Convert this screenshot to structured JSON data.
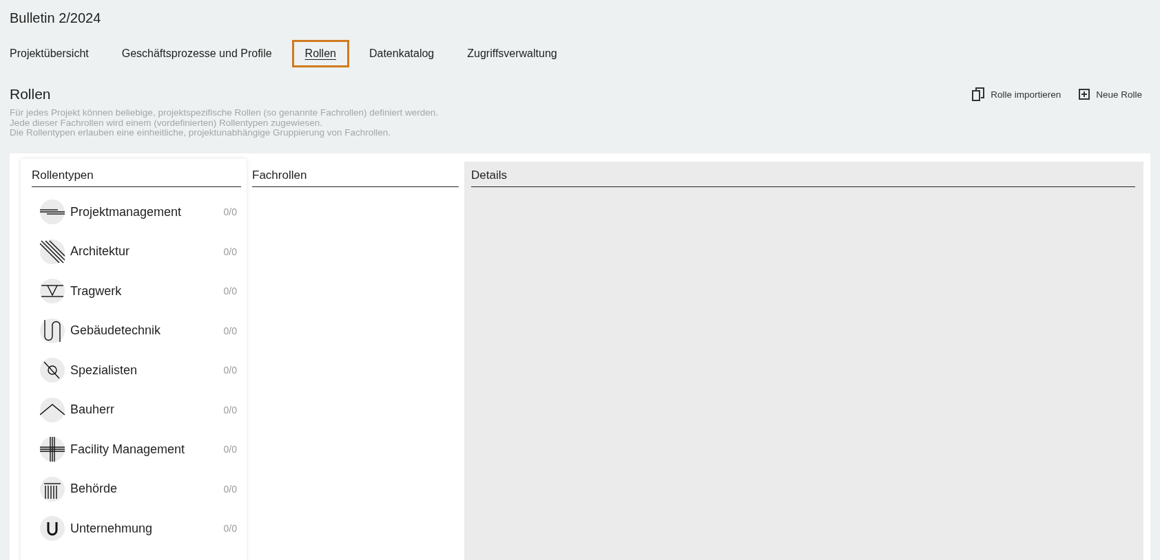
{
  "page_title": "Bulletin 2/2024",
  "tabs": [
    {
      "label": "Projektübersicht",
      "selected": false
    },
    {
      "label": "Geschäftsprozesse und Profile",
      "selected": false
    },
    {
      "label": "Rollen",
      "selected": true
    },
    {
      "label": "Datenkatalog",
      "selected": false
    },
    {
      "label": "Zugriffsverwaltung",
      "selected": false
    }
  ],
  "section": {
    "title": "Rollen",
    "description": [
      "Für jedes Projekt können beliebige, projektspezifische Rollen (so genannte Fachrollen) definiert werden.",
      "Jede dieser Fachrollen wird einem (vordefinierten) Rollentypen zugewiesen.",
      "Die Rollentypen erlauben eine einheitliche, projektunabhängige Gruppierung von Fachrollen."
    ],
    "actions": [
      {
        "kind": "import",
        "label": "Rolle importieren"
      },
      {
        "kind": "add",
        "label": "Neue Rolle"
      }
    ]
  },
  "role_types": {
    "title": "Rollentypen",
    "items": [
      {
        "kind": "lines",
        "label": "Projektmanagement",
        "count": "0/0"
      },
      {
        "kind": "hatch",
        "label": "Architektur",
        "count": "0/0"
      },
      {
        "kind": "support",
        "label": "Tragwerk",
        "count": "0/0"
      },
      {
        "kind": "loop",
        "label": "Gebäudetechnik",
        "count": "0/0"
      },
      {
        "kind": "lens",
        "label": "Spezialisten",
        "count": "0/0"
      },
      {
        "kind": "roof",
        "label": "Bauherr",
        "count": "0/0"
      },
      {
        "kind": "grid",
        "label": "Facility Management",
        "count": "0/0"
      },
      {
        "kind": "columns",
        "label": "Behörde",
        "count": "0/0"
      },
      {
        "kind": "u",
        "label": "Unternehmung",
        "count": "0/0"
      }
    ]
  },
  "roles": {
    "title": "Fachrollen"
  },
  "details": {
    "title": "Details"
  }
}
